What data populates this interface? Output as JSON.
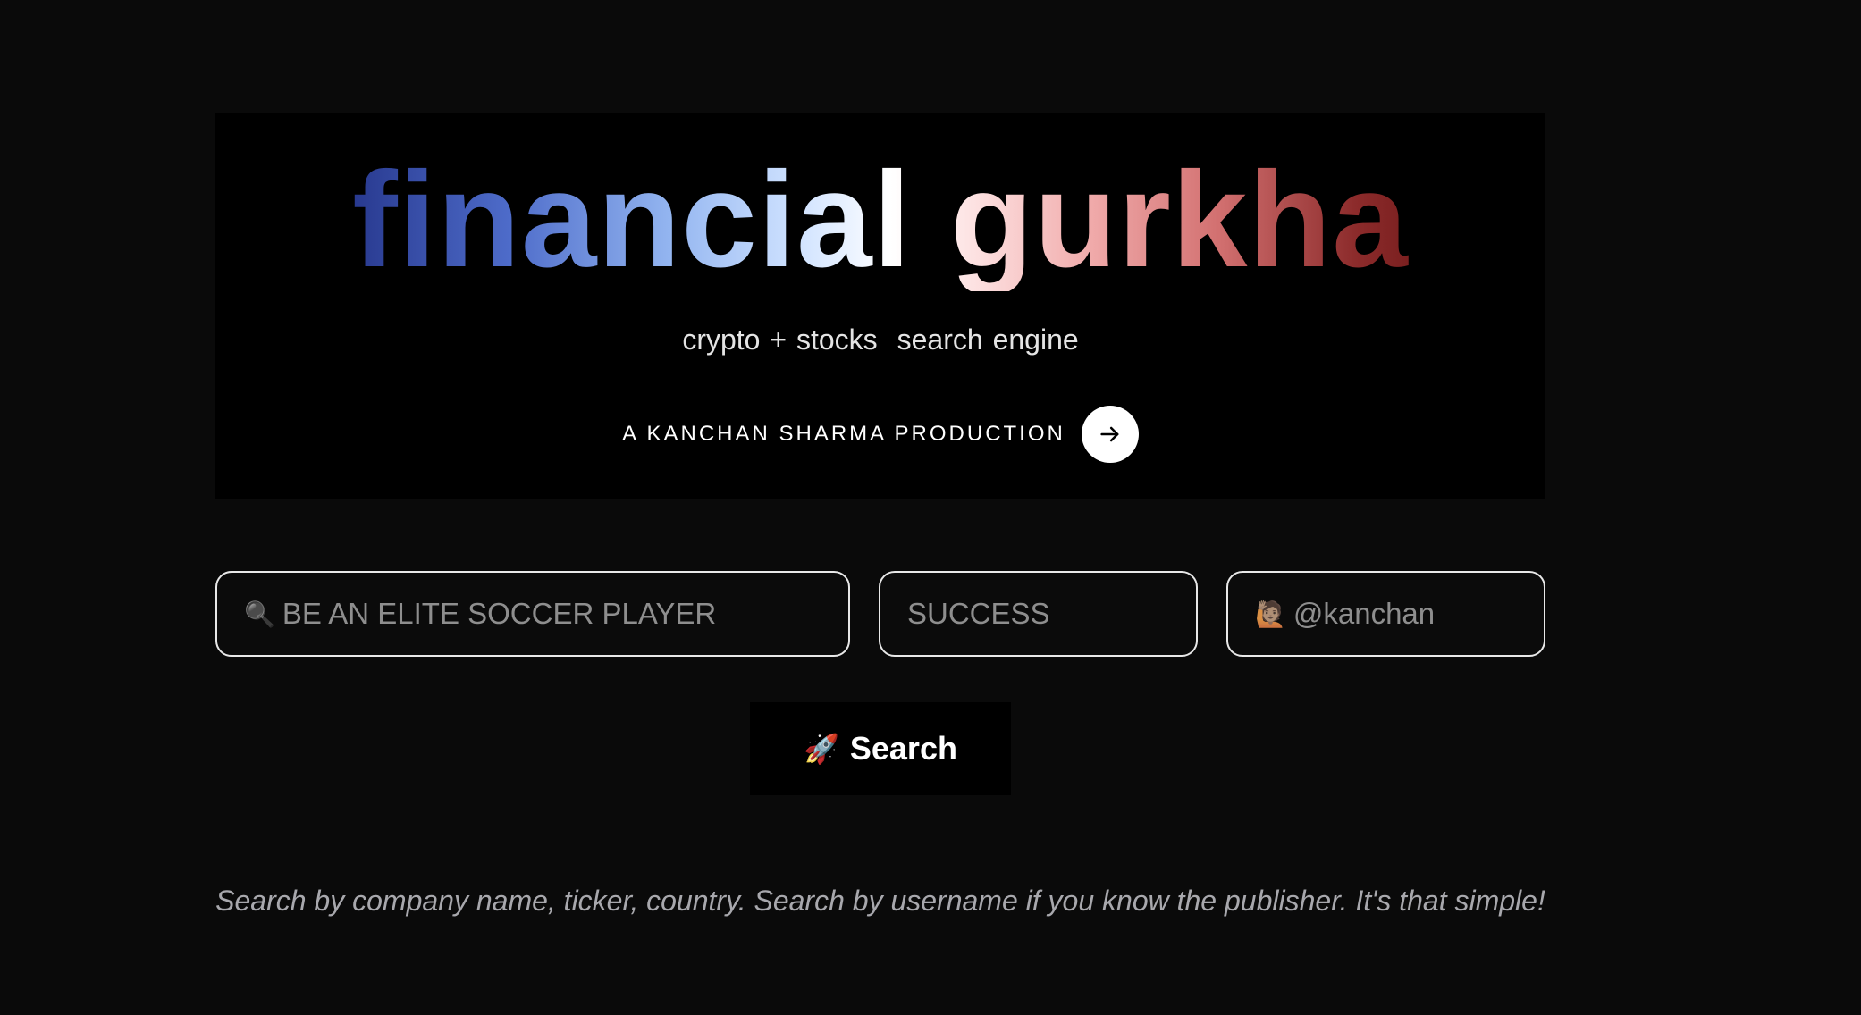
{
  "hero": {
    "title": "financial gurkha",
    "tagline_part1": "crypto + stocks",
    "tagline_part2": "search engine",
    "production_label": "A KANCHAN SHARMA PRODUCTION",
    "arrow_icon": "arrow-right-icon"
  },
  "search": {
    "query_placeholder": "BE AN ELITE SOCCER PLAYER",
    "query_icon": "🔍",
    "tag_placeholder": "SUCCESS",
    "user_placeholder": "@kanchan",
    "user_icon": "🙋🏽",
    "button_emoji": "🚀",
    "button_label": "Search"
  },
  "hint": "Search by company name, ticker, country. Search by username if you know the publisher. It's that simple!",
  "colors": {
    "page_background": "#0a0a0a",
    "hero_background": "#000000",
    "title_gradient_start": "#28398f",
    "title_gradient_mid": "#ffffff",
    "title_gradient_end": "#7b2020",
    "hint_text": "#a8a8ad"
  }
}
